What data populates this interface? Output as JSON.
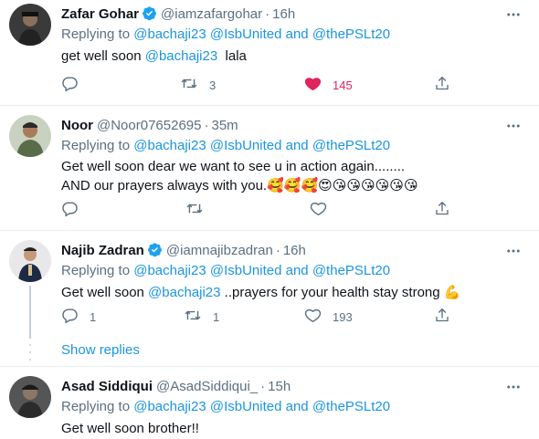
{
  "tweets": [
    {
      "name": "Zafar Gohar",
      "handle": "@iamzafargohar",
      "time": "16h",
      "replying_prefix": "Replying to ",
      "mentions": [
        "@bachaji23",
        "@IsbUnited",
        "and",
        "@thePSLt20"
      ],
      "text_main": "get well soon ",
      "text_mention": "@bachaji23",
      "text_after": "  lala",
      "replies": "",
      "retweets": "3",
      "likes": "145"
    },
    {
      "name": "Noor",
      "handle": "@Noor07652695",
      "time": "35m",
      "replying_prefix": "Replying to ",
      "mentions": [
        "@bachaji23",
        "@IsbUnited",
        "and",
        "@thePSLt20"
      ],
      "text_line1": "Get well soon dear we want to see u in action again........",
      "text_line2": "AND our prayers always with you.",
      "text_emoji": "🥰🥰🥰😍😘😘😘😘😘😘",
      "replies": "",
      "retweets": "",
      "likes": ""
    },
    {
      "name": "Najib Zadran",
      "handle": "@iamnajibzadran",
      "time": "16h",
      "replying_prefix": "Replying to ",
      "mentions": [
        "@bachaji23",
        "@IsbUnited",
        "and",
        "@thePSLt20"
      ],
      "text_main": "Get well soon ",
      "text_mention": "@bachaji23",
      "text_after": " ..prayers for your health stay strong ",
      "text_emoji": "💪",
      "replies": "1",
      "retweets": "1",
      "likes": "193"
    },
    {
      "name": "Asad Siddiqui",
      "handle": "@AsadSiddiqui_",
      "time": "15h",
      "replying_prefix": "Replying to ",
      "mentions": [
        "@bachaji23",
        "@IsbUnited",
        "and",
        "@thePSLt20"
      ],
      "text_main": "Get well soon brother!!"
    }
  ],
  "show_replies": "Show replies",
  "dot": "·",
  "icons": {
    "verified": "verified-badge-icon",
    "more": "more-icon",
    "reply": "reply-icon",
    "retweet": "retweet-icon",
    "like": "like-icon",
    "share": "share-icon"
  },
  "colors": {
    "link": "#1b95e0",
    "muted": "#5b7083",
    "like": "#e0245e",
    "verified": "#1da1f2"
  }
}
